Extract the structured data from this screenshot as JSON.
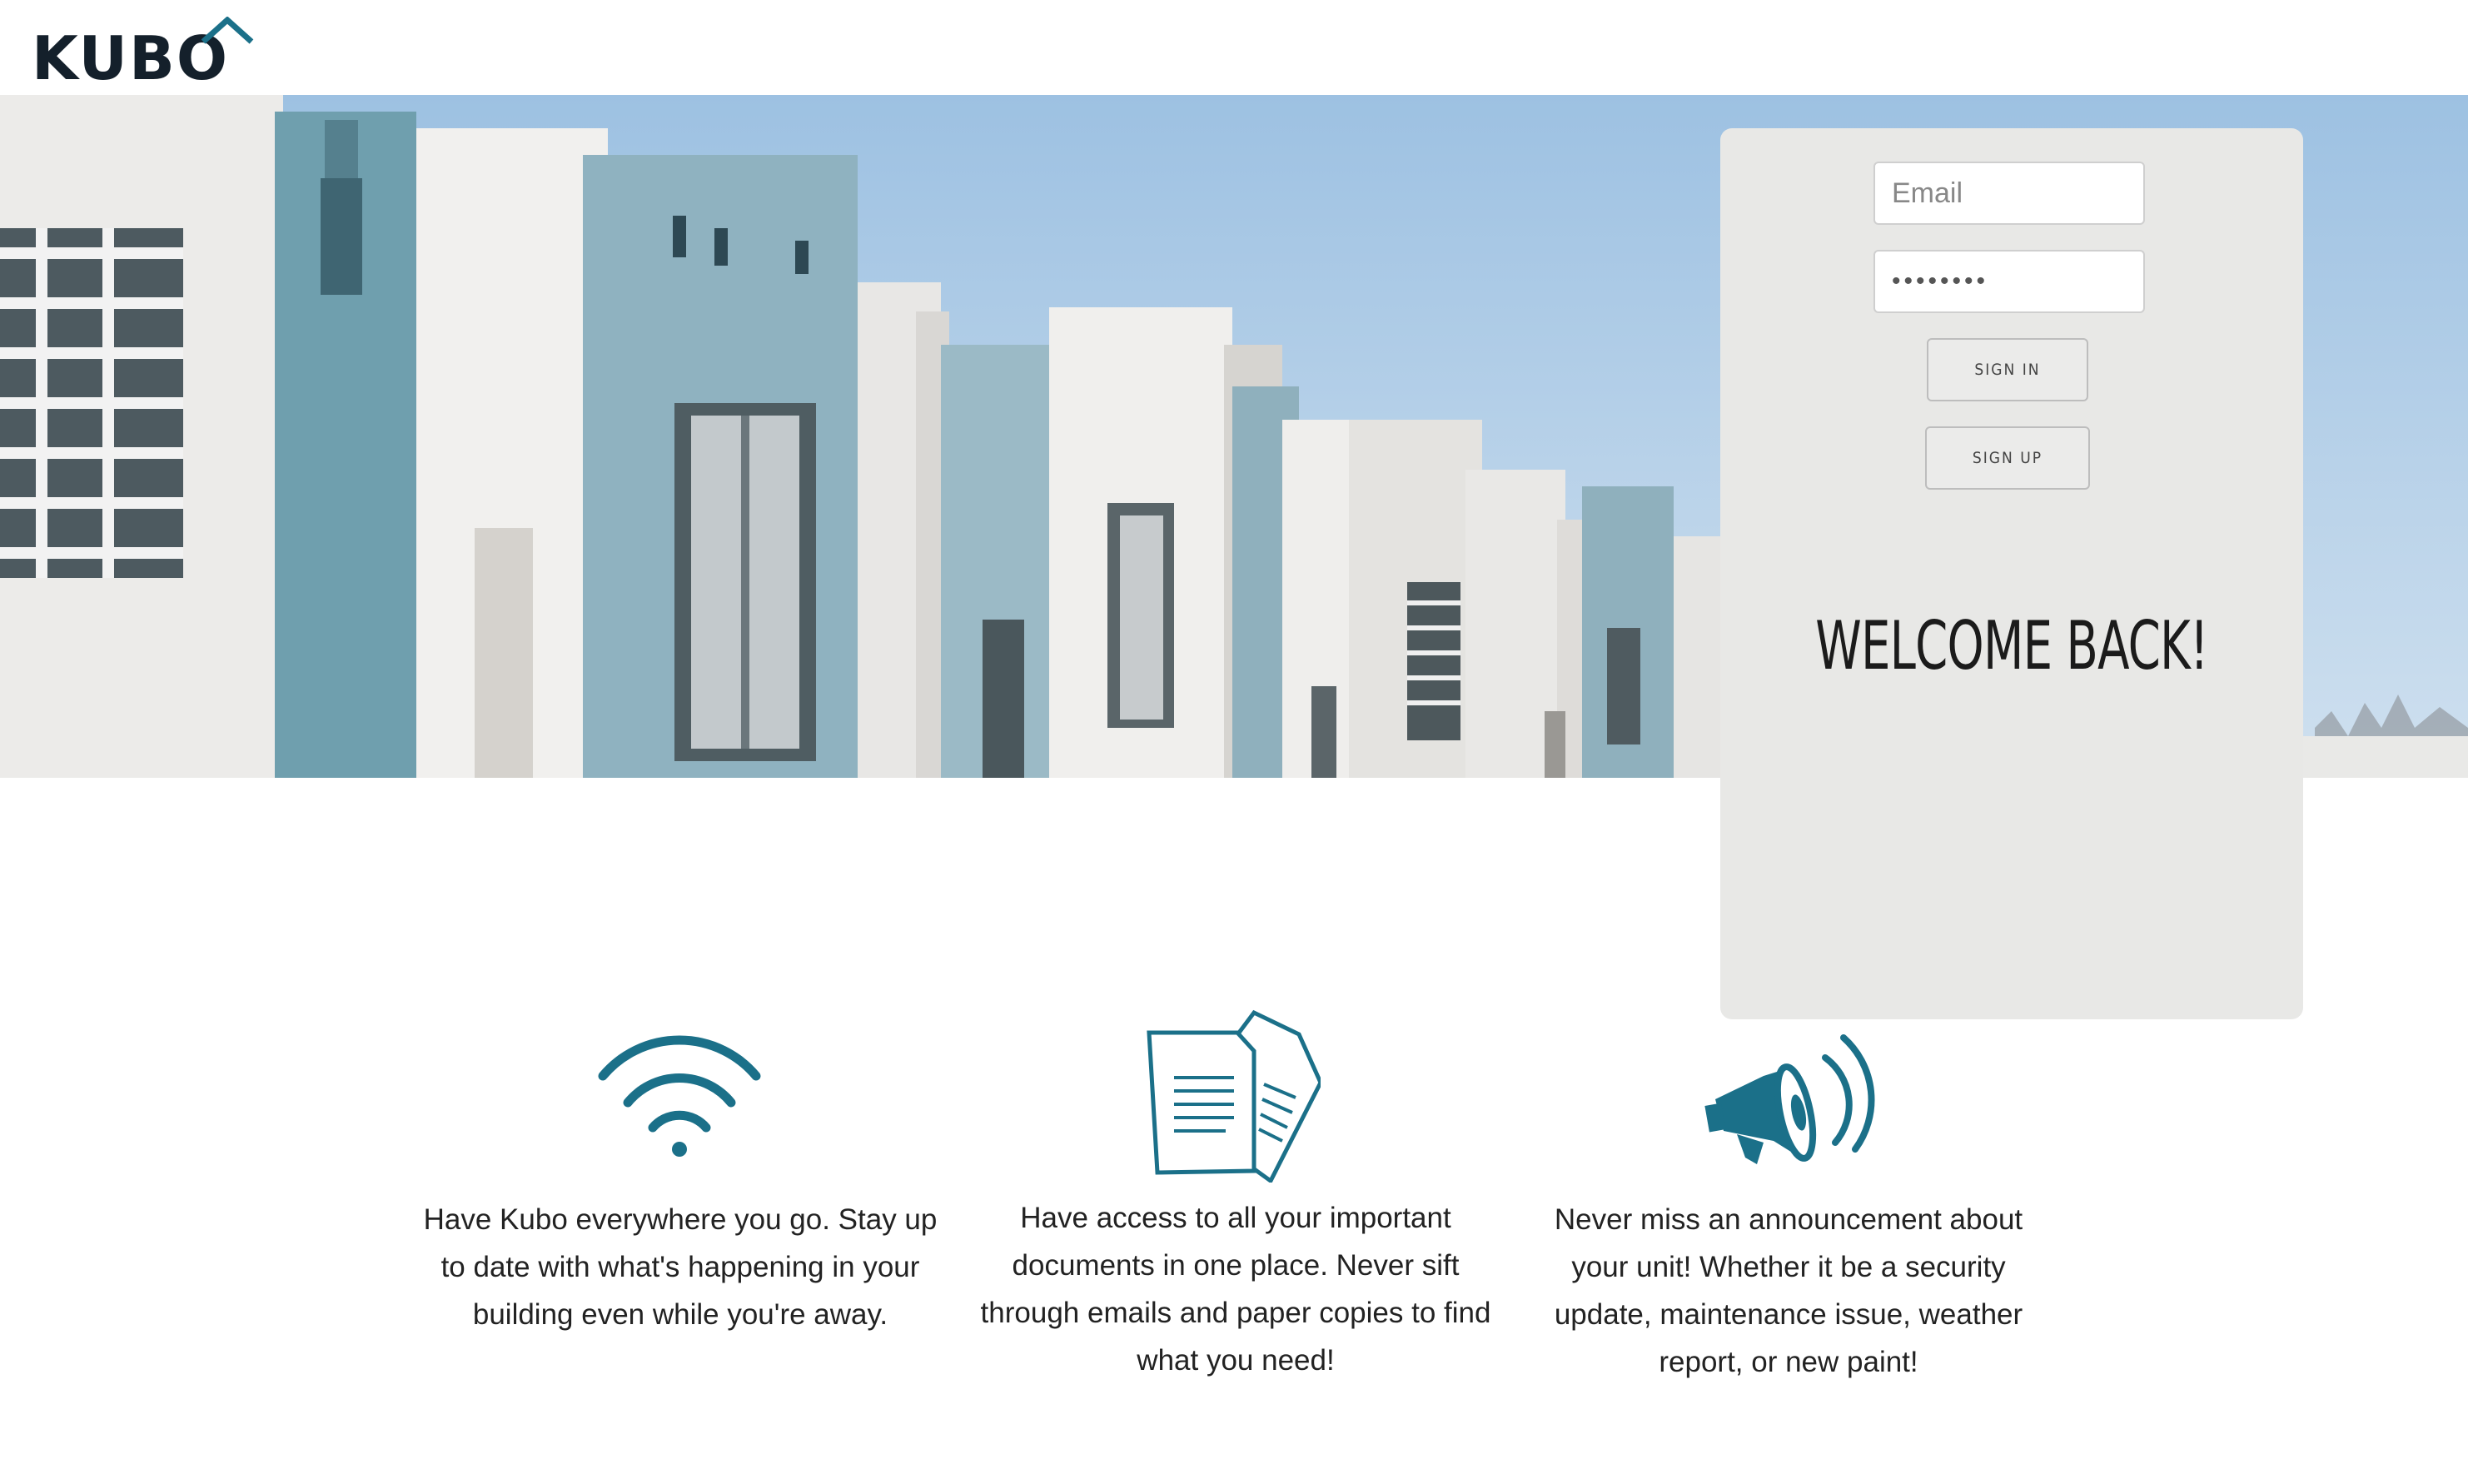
{
  "brand": {
    "name": "KUBO",
    "accent": "#1b7089",
    "dark": "#14202b"
  },
  "login": {
    "email_placeholder": "Email",
    "password_value": "••••••••",
    "sign_in_label": "SIGN IN",
    "sign_up_label": "SIGN UP",
    "welcome_text": "WELCOME BACK!"
  },
  "features": [
    {
      "icon": "wifi-icon",
      "text": "Have Kubo everywhere you go. Stay up to date with what's happening in your building even while you're away."
    },
    {
      "icon": "documents-icon",
      "text": "Have access to all your important documents in one place. Never sift through emails and paper copies to find what you need!"
    },
    {
      "icon": "megaphone-icon",
      "text": "Never miss an announcement about your unit! Whether it be a security update, maintenance issue, weather report, or new paint!"
    }
  ]
}
